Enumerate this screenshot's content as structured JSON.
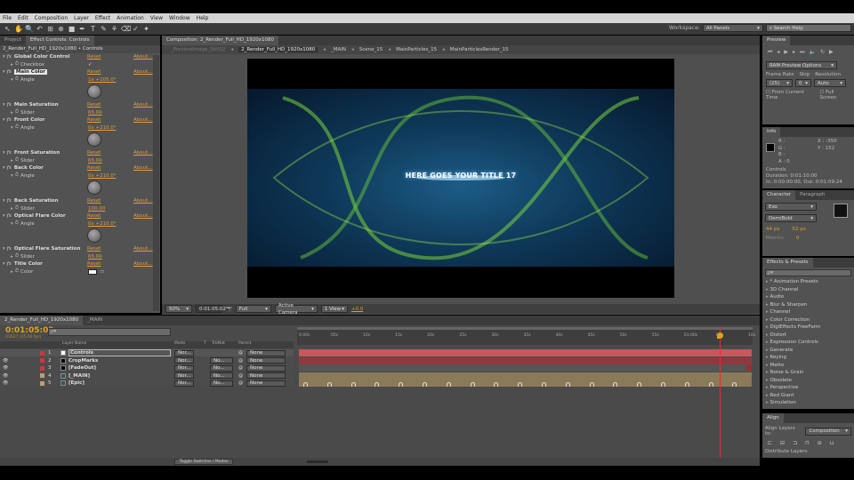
{
  "menu": [
    "File",
    "Edit",
    "Composition",
    "Layer",
    "Effect",
    "Animation",
    "View",
    "Window",
    "Help"
  ],
  "toolbar": {
    "tools": [
      "selection-tool",
      "hand-tool",
      "zoom-tool",
      "rotate-tool",
      "camera-tool",
      "pan-behind-tool",
      "rectangle-tool",
      "pen-tool",
      "type-tool",
      "brush-tool",
      "clone-stamp-tool",
      "eraser-tool",
      "roto-brush-tool",
      "puppet-tool"
    ],
    "workspace_label": "Workspace:",
    "workspace_value": "All Panels",
    "search_placeholder": "Search Help"
  },
  "effect_controls": {
    "tab_project": "Project",
    "tab_label": "Effect Controls: Controls",
    "breadcrumb": "2_Render_Full_HD_1920x1080 • Controls",
    "reset": "Reset",
    "about": "About...",
    "effects": [
      {
        "name": "Global Color Control",
        "prop": "Checkbox",
        "value": "✓",
        "type": "checkbox"
      },
      {
        "name": "Main Color",
        "prop": "Angle",
        "value": "1x +105.0°",
        "type": "angle"
      },
      {
        "name": "Main Saturation",
        "prop": "Slider",
        "value": "65.00",
        "type": "slider"
      },
      {
        "name": "Front Color",
        "prop": "Angle",
        "value": "0x +210.0°",
        "type": "angle"
      },
      {
        "name": "Front Saturation",
        "prop": "Slider",
        "value": "65.00",
        "type": "slider"
      },
      {
        "name": "Back Color",
        "prop": "Angle",
        "value": "0x +210.0°",
        "type": "angle"
      },
      {
        "name": "Back Saturation",
        "prop": "Slider",
        "value": "100.00",
        "type": "slider"
      },
      {
        "name": "Optical Flare Color",
        "prop": "Angle",
        "value": "0x +210.0°",
        "type": "angle"
      },
      {
        "name": "Optical Flare Saturation",
        "prop": "Slider",
        "value": "65.00",
        "type": "slider"
      },
      {
        "name": "Title Color",
        "prop": "Color",
        "value": "#ffffff",
        "type": "color"
      }
    ]
  },
  "composition": {
    "tab_label": "Composition: 2_Render_Full_HD_1920x1080",
    "nav": [
      "_PreviewImage_Still32",
      "2_Render_Full_HD_1920x1080",
      "_MAIN",
      "Scene_15",
      "MainParticles_15",
      "MainParticlesRender_15"
    ],
    "title_text": "HERE GOES YOUR TITLE 17",
    "viewer_bar": {
      "zoom": "50%",
      "timecode": "0:01:05:02",
      "resolution": "Full",
      "camera": "Active Camera",
      "views": "1 View",
      "exposure": "+0.0"
    }
  },
  "preview": {
    "tab": "Preview",
    "ram_options": "RAM Preview Options",
    "frame_rate_label": "Frame Rate",
    "skip_label": "Skip",
    "resolution_label": "Resolution",
    "frame_rate": "(25)",
    "skip": "0",
    "resolution": "Auto",
    "from_current": "From Current Time",
    "full_screen": "Full Screen"
  },
  "info": {
    "tab": "Info",
    "r": "R :",
    "g": "G :",
    "b": "B :",
    "a": "A : 0",
    "x": "X : -350",
    "y": "Y : 152",
    "layer": "Controls",
    "duration": "Duration: 0:01:10:00",
    "in_out": "In: 0:00:00:00, Out: 0:01:09:24"
  },
  "character": {
    "tab": "Character",
    "tab2": "Paragraph",
    "font": "Exo",
    "style": "DemiBold",
    "size": "44 px",
    "leading": "52 px",
    "kerning": "Metrics",
    "tracking": "0",
    "indent": "- px"
  },
  "effects_presets": {
    "tab": "Effects & Presets",
    "search_placeholder": "ρ▾",
    "items": [
      "* Animation Presets",
      "3D Channel",
      "Audio",
      "Blur & Sharpen",
      "Channel",
      "Color Correction",
      "DigiEffects FreeForm",
      "Distort",
      "Expression Controls",
      "Generate",
      "Keying",
      "Matte",
      "Noise & Grain",
      "Obsolete",
      "Perspective",
      "Red Giant",
      "Simulation"
    ]
  },
  "align": {
    "tab": "Align",
    "align_to_label": "Align Layers to:",
    "align_to": "Composition",
    "distribute_label": "Distribute Layers:"
  },
  "timeline": {
    "tabs": [
      "2_Render_Full_HD_1920x1080",
      "_MAIN"
    ],
    "timecode": "0:01:05:02",
    "frame_info": "01627 (25.00 fps)",
    "search_placeholder": "ρ▾",
    "headers": {
      "name": "Layer Name",
      "mode": "Mode",
      "t": "T",
      "trkmat": "TrkMat",
      "parent": "Parent"
    },
    "layers": [
      {
        "num": "1",
        "name": "Controls",
        "mode": "Nor...",
        "trkmat": "",
        "parent": "None",
        "label": "#c83a3a",
        "swatch": "#ffffff"
      },
      {
        "num": "2",
        "name": "CropMarks",
        "mode": "Nor...",
        "trkmat": "No...",
        "parent": "None",
        "label": "#c83a3a",
        "swatch": "#000000"
      },
      {
        "num": "3",
        "name": "[FadeOut]",
        "mode": "Nor...",
        "trkmat": "No...",
        "parent": "None",
        "label": "#c83a3a",
        "swatch": "#000000"
      },
      {
        "num": "4",
        "name": "[_MAIN]",
        "mode": "Nor...",
        "trkmat": "No...",
        "parent": "None",
        "label": "#b8a07a",
        "swatch": "#335566"
      },
      {
        "num": "5",
        "name": "[Epic]",
        "mode": "Nor...",
        "trkmat": "No...",
        "parent": "None",
        "label": "#b8a07a",
        "swatch": "#335566"
      }
    ],
    "ruler": [
      "0:00s",
      "05s",
      "10s",
      "15s",
      "20s",
      "25s",
      "30s",
      "35s",
      "40s",
      "45s",
      "50s",
      "55s",
      "01:00s",
      "05s",
      "10s"
    ],
    "playhead_fraction": 0.93,
    "toggle_label": "Toggle Switches / Modes"
  }
}
